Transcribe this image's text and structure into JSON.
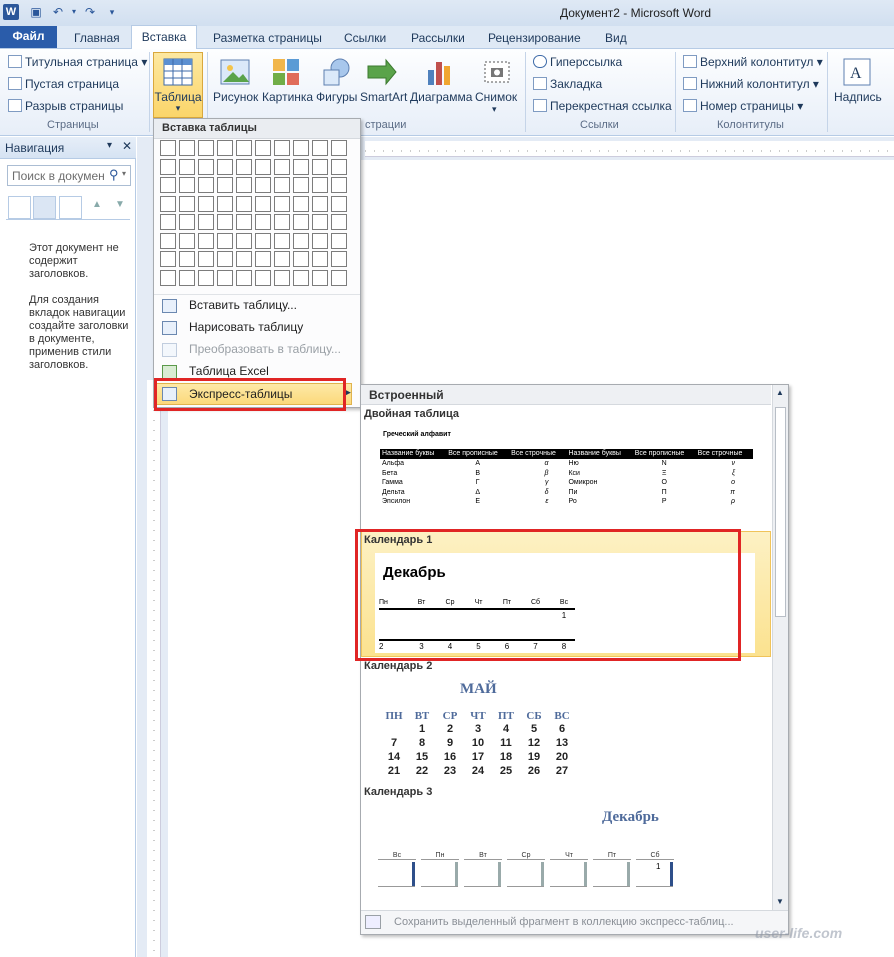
{
  "window": {
    "title": "Документ2 - Microsoft Word"
  },
  "tabs": [
    {
      "label": "Файл"
    },
    {
      "label": "Главная"
    },
    {
      "label": "Вставка"
    },
    {
      "label": "Разметка страницы"
    },
    {
      "label": "Ссылки"
    },
    {
      "label": "Рассылки"
    },
    {
      "label": "Рецензирование"
    },
    {
      "label": "Вид"
    }
  ],
  "ribbon": {
    "pages": {
      "label": "Страницы",
      "items": [
        "Титульная страница",
        "Пустая страница",
        "Разрыв страницы"
      ]
    },
    "tables": {
      "label": "Таблица"
    },
    "illustrations": {
      "label": "Иллюстрации",
      "label_visible": "страции",
      "items": [
        "Рисунок",
        "Картинка",
        "Фигуры",
        "SmartArt",
        "Диаграмма",
        "Снимок"
      ]
    },
    "links": {
      "label": "Ссылки",
      "items": [
        "Гиперссылка",
        "Закладка",
        "Перекрестная ссылка"
      ]
    },
    "headerfooter": {
      "label": "Колонтитулы",
      "items": [
        "Верхний колонтитул",
        "Нижний колонтитул",
        "Номер страницы"
      ]
    },
    "text": {
      "items": [
        "Надпись"
      ]
    }
  },
  "navigation": {
    "title": "Навигация",
    "search_placeholder": "Поиск в докумен",
    "message1": "Этот документ не содержит заголовков.",
    "message2": "Для создания вкладок навигации создайте заголовки в документе, применив стили заголовков."
  },
  "table_menu": {
    "title": "Вставка таблицы",
    "grid_cols": 10,
    "grid_rows": 8,
    "items": [
      {
        "label": "Вставить таблицу...",
        "enabled": true
      },
      {
        "label": "Нарисовать таблицу",
        "enabled": true
      },
      {
        "label": "Преобразовать в таблицу...",
        "enabled": false
      },
      {
        "label": "Таблица Excel",
        "enabled": true
      },
      {
        "label": "Экспресс-таблицы",
        "enabled": true
      }
    ]
  },
  "gallery": {
    "header": "Встроенный",
    "double_table": {
      "label": "Двойная таблица",
      "caption": "Греческий алфавит",
      "headers": [
        "Название буквы",
        "Все прописные",
        "Все строчные",
        "Название буквы",
        "Все прописные",
        "Все строчные"
      ],
      "rows": [
        [
          "Альфа",
          "A",
          "α",
          "Ню",
          "N",
          "ν"
        ],
        [
          "Бета",
          "B",
          "β",
          "Кси",
          "Ξ",
          "ξ"
        ],
        [
          "Гамма",
          "Γ",
          "γ",
          "Омикрон",
          "O",
          "ο"
        ],
        [
          "Дельта",
          "Δ",
          "δ",
          "Пи",
          "Π",
          "π"
        ],
        [
          "Эпсилон",
          "E",
          "ε",
          "Ро",
          "P",
          "ρ"
        ]
      ]
    },
    "calendar1": {
      "label": "Календарь 1",
      "month": "Декабрь",
      "days": [
        "Пн",
        "Вт",
        "Ср",
        "Чт",
        "Пт",
        "Сб",
        "Вс"
      ],
      "row1": [
        "",
        "",
        "",
        "",
        "",
        "",
        "1"
      ],
      "row2": [
        "2",
        "3",
        "4",
        "5",
        "6",
        "7",
        "8"
      ]
    },
    "calendar2": {
      "label": "Календарь 2",
      "month": "МАЙ",
      "days": [
        "ПН",
        "ВТ",
        "СР",
        "ЧТ",
        "ПТ",
        "СБ",
        "ВС"
      ],
      "weeks": [
        [
          "",
          "1",
          "2",
          "3",
          "4",
          "5",
          "6"
        ],
        [
          "7",
          "8",
          "9",
          "10",
          "11",
          "12",
          "13"
        ],
        [
          "14",
          "15",
          "16",
          "17",
          "18",
          "19",
          "20"
        ],
        [
          "21",
          "22",
          "23",
          "24",
          "25",
          "26",
          "27"
        ]
      ]
    },
    "calendar3": {
      "label": "Календарь 3",
      "month": "Декабрь",
      "days": [
        "Вс",
        "Пн",
        "Вт",
        "Ср",
        "Чт",
        "Пт",
        "Сб"
      ],
      "first": "1"
    },
    "footer": "Сохранить выделенный фрагмент в коллекцию экспресс-таблиц..."
  },
  "watermark": "user-life.com"
}
